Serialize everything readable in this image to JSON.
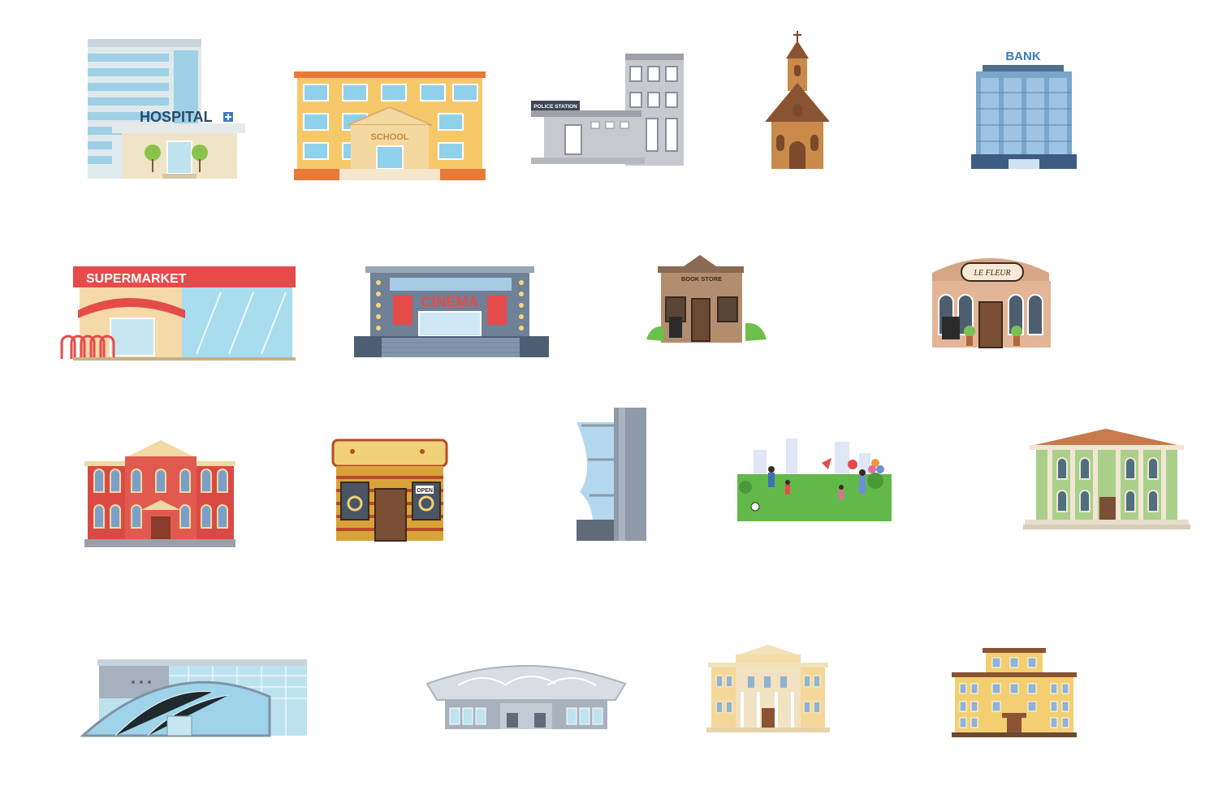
{
  "signs": {
    "hospital": "HOSPITAL",
    "school": "SCHOOL",
    "police": "POLICE STATION",
    "bank": "BANK",
    "supermarket": "SUPERMARKET",
    "cinema": "CINEMA",
    "bookstore": "BOOK STORE",
    "cafe": "LE FLEUR",
    "open": "OPEN"
  },
  "palette": {
    "hospital_sign": "#2b4a6b",
    "school_wall": "#f7c86a",
    "supermarket_band": "#e54b4b",
    "cinema_sign": "#e54b4b",
    "bank_sign": "#3a7bbf",
    "park_grass": "#63b84a"
  }
}
